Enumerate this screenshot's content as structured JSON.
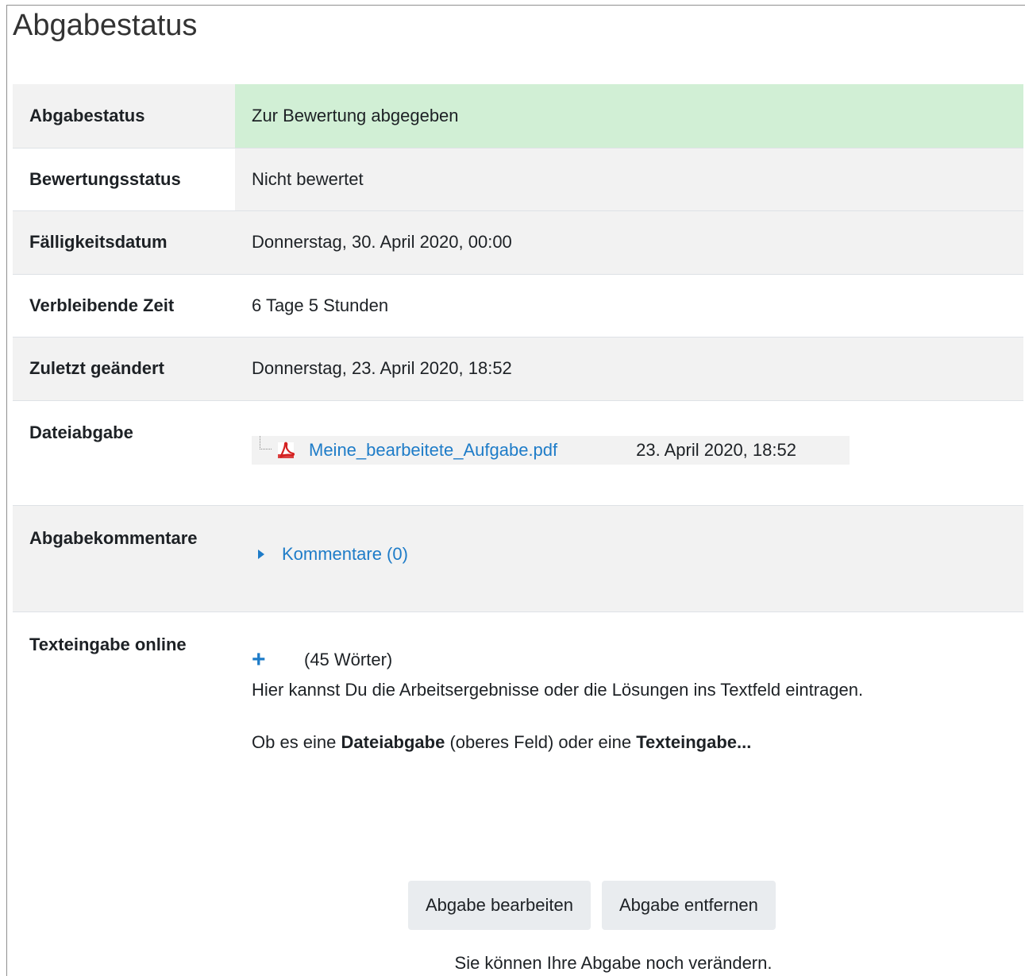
{
  "page": {
    "title": "Abgabestatus"
  },
  "rows": {
    "submission_status": {
      "label": "Abgabestatus",
      "value": "Zur Bewertung abgegeben"
    },
    "grading_status": {
      "label": "Bewertungsstatus",
      "value": "Nicht bewertet"
    },
    "due_date": {
      "label": "Fälligkeitsdatum",
      "value": "Donnerstag, 30. April 2020, 00:00"
    },
    "time_remaining": {
      "label": "Verbleibende Zeit",
      "value": "6 Tage 5 Stunden"
    },
    "last_modified": {
      "label": "Zuletzt geändert",
      "value": "Donnerstag, 23. April 2020, 18:52"
    },
    "file_submission": {
      "label": "Dateiabgabe",
      "file_name": "Meine_bearbeitete_Aufgabe.pdf",
      "file_date": "23. April 2020, 18:52",
      "file_icon": "pdf-icon"
    },
    "comments": {
      "label": "Abgabekommentare",
      "toggle_label": "Kommentare (0)"
    },
    "online_text": {
      "label": "Texteingabe online",
      "expand_icon": "plus-icon",
      "word_count": "(45 Wörter)",
      "paragraph1": "Hier kannst Du die Arbeitsergebnisse oder die Lösungen ins Textfeld eintragen.",
      "paragraph2_prefix": "Ob es eine ",
      "paragraph2_bold1": "Dateiabgabe",
      "paragraph2_middle": " (oberes Feld) oder eine ",
      "paragraph2_bold2": "Texteingabe..."
    }
  },
  "actions": {
    "edit_label": "Abgabe bearbeiten",
    "remove_label": "Abgabe entfernen",
    "note": "Sie können Ihre Abgabe noch verändern."
  },
  "colors": {
    "success_bg": "#d1efd5",
    "link": "#1e7cc8",
    "pdf_red": "#d42020"
  }
}
